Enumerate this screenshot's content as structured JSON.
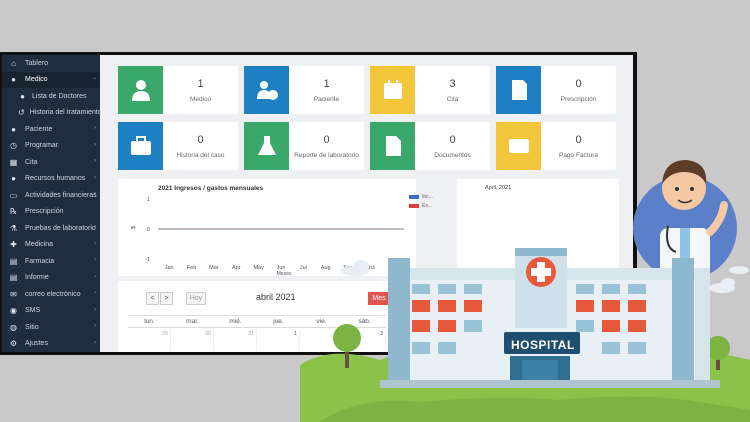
{
  "sidebar": {
    "items": [
      {
        "label": "Tablero",
        "icon": "home-icon",
        "caret": false,
        "sub": false,
        "active": false
      },
      {
        "label": "Medico",
        "icon": "user-icon",
        "caret": true,
        "sub": false,
        "active": true
      },
      {
        "label": "Lista de Doctores",
        "icon": "user-icon",
        "caret": false,
        "sub": true,
        "active": false
      },
      {
        "label": "Historia del tratamiento",
        "icon": "history-icon",
        "caret": false,
        "sub": true,
        "active": false
      },
      {
        "label": "Paciente",
        "icon": "users-icon",
        "caret": true,
        "sub": false,
        "active": false
      },
      {
        "label": "Programar",
        "icon": "clock-icon",
        "caret": true,
        "sub": false,
        "active": false
      },
      {
        "label": "Cita",
        "icon": "calendar-icon",
        "caret": true,
        "sub": false,
        "active": false
      },
      {
        "label": "Recursos humanos",
        "icon": "people-icon",
        "caret": true,
        "sub": false,
        "active": false
      },
      {
        "label": "Actividades financieras",
        "icon": "money-icon",
        "caret": true,
        "sub": false,
        "active": false
      },
      {
        "label": "Prescripción",
        "icon": "rx-icon",
        "caret": false,
        "sub": false,
        "active": false
      },
      {
        "label": "Pruebas de laboratorio",
        "icon": "flask-icon",
        "caret": true,
        "sub": false,
        "active": false
      },
      {
        "label": "Medicina",
        "icon": "medicine-icon",
        "caret": true,
        "sub": false,
        "active": false
      },
      {
        "label": "Farmacia",
        "icon": "pharmacy-icon",
        "caret": true,
        "sub": false,
        "active": false
      },
      {
        "label": "Informe",
        "icon": "report-icon",
        "caret": true,
        "sub": false,
        "active": false
      },
      {
        "label": "correo electrónico",
        "icon": "mail-icon",
        "caret": true,
        "sub": false,
        "active": false
      },
      {
        "label": "SMS",
        "icon": "sms-icon",
        "caret": true,
        "sub": false,
        "active": false
      },
      {
        "label": "Sitio",
        "icon": "globe-icon",
        "caret": true,
        "sub": false,
        "active": false
      },
      {
        "label": "Ajustes",
        "icon": "gear-icon",
        "caret": true,
        "sub": false,
        "active": false
      }
    ]
  },
  "cards": [
    {
      "value": "1",
      "label": "Medico",
      "color": "#3aa86b",
      "icon": "doctor-icon"
    },
    {
      "value": "1",
      "label": "Paciente",
      "color": "#1e7fc2",
      "icon": "add-user-icon"
    },
    {
      "value": "3",
      "label": "Cita",
      "color": "#f3c53b",
      "icon": "calendar-icon"
    },
    {
      "value": "0",
      "label": "Prescripción",
      "color": "#1e7fc2",
      "icon": "prescription-icon"
    },
    {
      "value": "0",
      "label": "Historia del caso",
      "color": "#1e7fc2",
      "icon": "medkit-icon"
    },
    {
      "value": "0",
      "label": "Reporte de laboratorio",
      "color": "#3aa86b",
      "icon": "flask-icon"
    },
    {
      "value": "0",
      "label": "Documentos",
      "color": "#3aa86b",
      "icon": "document-icon"
    },
    {
      "value": "0",
      "label": "Pago Factura",
      "color": "#f3c53b",
      "icon": "credit-card-icon"
    }
  ],
  "chart_data": {
    "type": "line",
    "title": "2021 Ingresos / gastos mensuales",
    "xlabel": "Meses",
    "ylabel": "$",
    "categories": [
      "Jan",
      "Feb",
      "Mar",
      "Apr",
      "May",
      "Jun",
      "Jul",
      "Aug",
      "Sep",
      "Oct",
      "Nov"
    ],
    "ylim": [
      -1,
      1
    ],
    "yticks": [
      "1",
      "0",
      "-1"
    ],
    "series": [
      {
        "name": "Inc...",
        "color": "#3b6fc1",
        "values": [
          0,
          0,
          0,
          0,
          0,
          0,
          0,
          0,
          0,
          0,
          0
        ]
      },
      {
        "name": "Ex...",
        "color": "#d9433a",
        "values": [
          0,
          0,
          0,
          0,
          0,
          0,
          0,
          0,
          0,
          0,
          0
        ]
      }
    ]
  },
  "side_panel": {
    "title": "April, 2021"
  },
  "calendar": {
    "prev": "<",
    "next": ">",
    "today": "Hoy",
    "title": "abril 2021",
    "view": "Mes",
    "weekdays": [
      "lun.",
      "mar.",
      "mié.",
      "jue.",
      "vie.",
      "sáb."
    ],
    "days": [
      "29",
      "30",
      "31",
      "1",
      "2",
      "3"
    ]
  },
  "illustration": {
    "sign": "HOSPITAL"
  }
}
